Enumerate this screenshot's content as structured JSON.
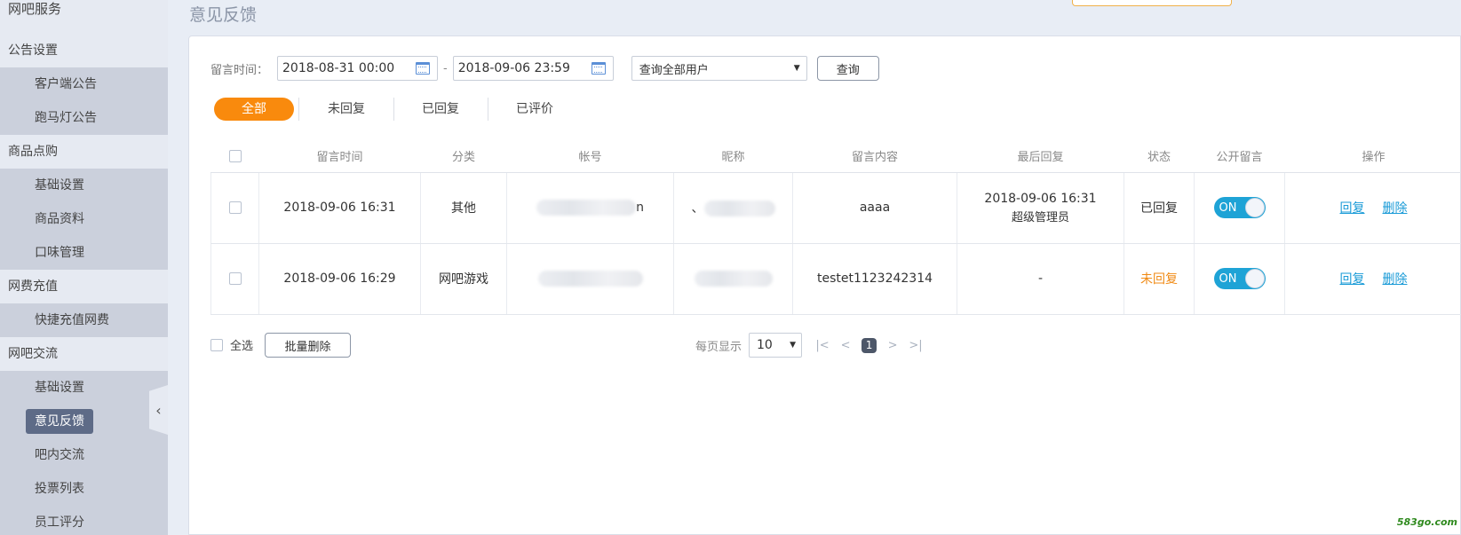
{
  "sidebar": {
    "items": [
      {
        "type": "section",
        "label": "网吧服务"
      },
      {
        "type": "section",
        "label": "公告设置"
      },
      {
        "type": "item",
        "label": "客户端公告"
      },
      {
        "type": "item",
        "label": "跑马灯公告"
      },
      {
        "type": "section",
        "label": "商品点购"
      },
      {
        "type": "item",
        "label": "基础设置"
      },
      {
        "type": "item",
        "label": "商品资料"
      },
      {
        "type": "item",
        "label": "口味管理"
      },
      {
        "type": "section",
        "label": "网费充值"
      },
      {
        "type": "item",
        "label": "快捷充值网费"
      },
      {
        "type": "section",
        "label": "网吧交流"
      },
      {
        "type": "item",
        "label": "基础设置"
      },
      {
        "type": "item",
        "label": "意见反馈",
        "active": true
      },
      {
        "type": "item",
        "label": "吧内交流"
      },
      {
        "type": "item",
        "label": "投票列表"
      },
      {
        "type": "item",
        "label": "员工评分"
      }
    ],
    "collapse_icon": "chevron-left-icon"
  },
  "page": {
    "title": "意见反馈"
  },
  "filter": {
    "label": "留言时间：",
    "start": "2018-08-31 00:00",
    "separator": "-",
    "end": "2018-09-06 23:59",
    "user_select": "查询全部用户",
    "query_button": "查询"
  },
  "tabs": [
    "全部",
    "未回复",
    "已回复",
    "已评价"
  ],
  "table": {
    "headers": [
      "",
      "留言时间",
      "分类",
      "帐号",
      "昵称",
      "留言内容",
      "最后回复",
      "状态",
      "公开留言",
      "操作"
    ],
    "rows": [
      {
        "time": "2018-09-06 16:31",
        "category": "其他",
        "account_tail": "n",
        "nickname_lead": "、",
        "content": "aaaa",
        "last_reply_time": "2018-09-06 16:31",
        "last_reply_by": "超级管理员",
        "status": "已回复",
        "public": "ON",
        "reply": "回复",
        "delete": "删除"
      },
      {
        "time": "2018-09-06 16:29",
        "category": "网吧游戏",
        "account_tail": "",
        "nickname_lead": "",
        "content": "testet1123242314",
        "last_reply_time": "-",
        "last_reply_by": "",
        "status": "未回复",
        "public": "ON",
        "reply": "回复",
        "delete": "删除"
      }
    ]
  },
  "footer": {
    "select_all": "全选",
    "batch_delete": "批量删除",
    "per_page_label": "每页显示",
    "per_page": "10",
    "current_page": "1"
  },
  "colors": {
    "accent": "#f98a0d",
    "toggle": "#1ea3d6",
    "link": "#1a9bd7",
    "unreplied": "#f08a14"
  },
  "watermark": "583go.com"
}
